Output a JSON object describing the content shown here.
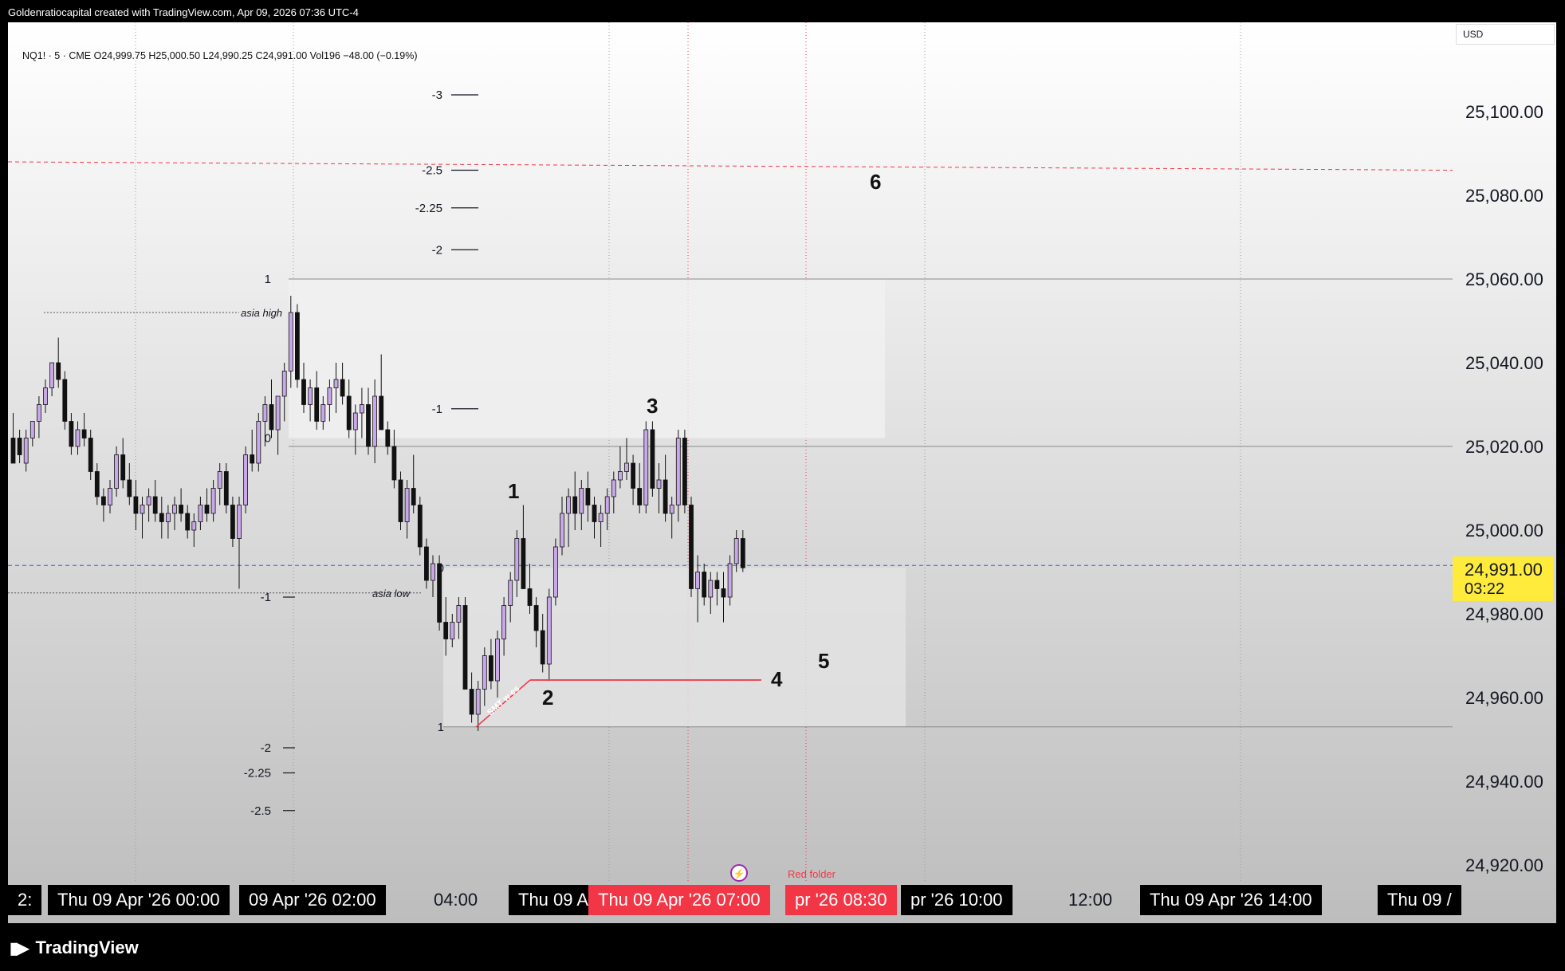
{
  "header": {
    "attribution": "Goldenratiocapital created with TradingView.com, Apr 09, 2026 07:36 UTC-4"
  },
  "legend": {
    "text": "NQ1! · 5 · CME  O24,999.75  H25,000.50  L24,990.25  C24,991.00  Vol196  −48.00 (−0.19%)"
  },
  "price_axis": {
    "currency": "USD",
    "ticks": [
      "25,100.00",
      "25,080.00",
      "25,060.00",
      "25,040.00",
      "25,020.00",
      "25,000.00",
      "24,980.00",
      "24,960.00",
      "24,940.00",
      "24,920.00"
    ],
    "last_price": "24,991.00",
    "countdown": "03:22"
  },
  "time_axis": {
    "labels": [
      {
        "text": "2:",
        "style": "dark"
      },
      {
        "text": "Thu 09 Apr '26   00:00",
        "style": "dark"
      },
      {
        "text": "09 Apr '26   02:00",
        "style": "dark"
      },
      {
        "text": "04:00",
        "style": "plain"
      },
      {
        "text": "Thu 09 A",
        "style": "dark"
      },
      {
        "text": "Thu 09 Apr '26   07:00",
        "style": "red"
      },
      {
        "text": "pr '26   08:30",
        "style": "red"
      },
      {
        "text": "pr '26   10:00",
        "style": "dark"
      },
      {
        "text": "12:00",
        "style": "plain"
      },
      {
        "text": "Thu 09 Apr '26   14:00",
        "style": "dark"
      },
      {
        "text": "Thu 09 /",
        "style": "dark"
      }
    ]
  },
  "footer": {
    "logo": "TradingView"
  },
  "chart_data": {
    "type": "candlestick",
    "symbol": "NQ1!",
    "interval": "5",
    "exchange": "CME",
    "ylim": [
      24910,
      25120
    ],
    "current_price": 24991.0,
    "candles": [
      [
        25022,
        25028,
        25018,
        25016
      ],
      [
        25022,
        25024,
        25016,
        25018
      ],
      [
        25016,
        25024,
        25014,
        25022
      ],
      [
        25022,
        25026,
        25020,
        25026
      ],
      [
        25026,
        25032,
        25022,
        25030
      ],
      [
        25030,
        25036,
        25028,
        25034
      ],
      [
        25034,
        25040,
        25032,
        25040
      ],
      [
        25040,
        25046,
        25034,
        25036
      ],
      [
        25036,
        25038,
        25024,
        25026
      ],
      [
        25026,
        25028,
        25018,
        25020
      ],
      [
        25020,
        25026,
        25018,
        25024
      ],
      [
        25024,
        25028,
        25020,
        25022
      ],
      [
        25022,
        25024,
        25012,
        25014
      ],
      [
        25014,
        25016,
        25006,
        25008
      ],
      [
        25008,
        25010,
        25002,
        25006
      ],
      [
        25006,
        25012,
        25004,
        25010
      ],
      [
        25010,
        25020,
        25008,
        25018
      ],
      [
        25018,
        25022,
        25010,
        25012
      ],
      [
        25012,
        25016,
        25006,
        25008
      ],
      [
        25008,
        25012,
        25000,
        25004
      ],
      [
        25004,
        25008,
        24998,
        25006
      ],
      [
        25006,
        25010,
        25002,
        25008
      ],
      [
        25008,
        25012,
        25002,
        25004
      ],
      [
        25004,
        25008,
        24998,
        25002
      ],
      [
        25002,
        25006,
        24998,
        25004
      ],
      [
        25004,
        25008,
        25000,
        25006
      ],
      [
        25006,
        25010,
        25002,
        25004
      ],
      [
        25004,
        25006,
        24998,
        25000
      ],
      [
        25000,
        25004,
        24996,
        25002
      ],
      [
        25002,
        25008,
        25000,
        25006
      ],
      [
        25006,
        25010,
        25002,
        25004
      ],
      [
        25004,
        25012,
        25002,
        25010
      ],
      [
        25010,
        25016,
        25006,
        25014
      ],
      [
        25014,
        25016,
        25004,
        25006
      ],
      [
        25006,
        25008,
        24996,
        24998
      ],
      [
        24998,
        25008,
        24986,
        25006
      ],
      [
        25006,
        25020,
        25004,
        25018
      ],
      [
        25018,
        25024,
        25014,
        25016
      ],
      [
        25016,
        25028,
        25014,
        25026
      ],
      [
        25026,
        25032,
        25020,
        25030
      ],
      [
        25030,
        25036,
        25022,
        25024
      ],
      [
        25024,
        25032,
        25018,
        25032
      ],
      [
        25032,
        25040,
        25026,
        25038
      ],
      [
        25038,
        25056,
        25034,
        25052
      ],
      [
        25052,
        25054,
        25034,
        25036
      ],
      [
        25036,
        25040,
        25028,
        25030
      ],
      [
        25030,
        25036,
        25026,
        25034
      ],
      [
        25034,
        25038,
        25024,
        25026
      ],
      [
        25026,
        25032,
        25024,
        25030
      ],
      [
        25030,
        25036,
        25026,
        25034
      ],
      [
        25034,
        25040,
        25028,
        25036
      ],
      [
        25036,
        25040,
        25030,
        25032
      ],
      [
        25032,
        25036,
        25022,
        25024
      ],
      [
        25024,
        25030,
        25018,
        25028
      ],
      [
        25028,
        25034,
        25022,
        25030
      ],
      [
        25030,
        25034,
        25018,
        25020
      ],
      [
        25020,
        25036,
        25016,
        25032
      ],
      [
        25032,
        25042,
        25024,
        25024
      ],
      [
        25024,
        25026,
        25018,
        25020
      ],
      [
        25020,
        25024,
        25010,
        25012
      ],
      [
        25012,
        25014,
        25000,
        25002
      ],
      [
        25002,
        25012,
        24998,
        25010
      ],
      [
        25010,
        25018,
        25004,
        25006
      ],
      [
        25006,
        25008,
        24994,
        24996
      ],
      [
        24996,
        24998,
        24986,
        24988
      ],
      [
        24988,
        24994,
        24984,
        24992
      ],
      [
        24992,
        24994,
        24976,
        24978
      ],
      [
        24978,
        24984,
        24970,
        24974
      ],
      [
        24974,
        24980,
        24972,
        24978
      ],
      [
        24978,
        24984,
        24974,
        24982
      ],
      [
        24982,
        24984,
        24962,
        24962
      ],
      [
        24962,
        24966,
        24954,
        24956
      ],
      [
        24956,
        24964,
        24952,
        24962
      ],
      [
        24962,
        24972,
        24958,
        24970
      ],
      [
        24970,
        24974,
        24962,
        24964
      ],
      [
        24964,
        24976,
        24960,
        24974
      ],
      [
        24974,
        24984,
        24970,
        24982
      ],
      [
        24982,
        24990,
        24978,
        24988
      ],
      [
        24988,
        25000,
        24984,
        24998
      ],
      [
        24998,
        25006,
        24986,
        24986
      ],
      [
        24986,
        24992,
        24980,
        24982
      ],
      [
        24982,
        24984,
        24972,
        24976
      ],
      [
        24976,
        24980,
        24966,
        24968
      ],
      [
        24968,
        24986,
        24964,
        24984
      ],
      [
        24984,
        24998,
        24982,
        24996
      ],
      [
        24996,
        25008,
        24994,
        25004
      ],
      [
        25004,
        25010,
        24996,
        25008
      ],
      [
        25008,
        25014,
        25000,
        25004
      ],
      [
        25004,
        25012,
        25000,
        25010
      ],
      [
        25010,
        25014,
        25002,
        25006
      ],
      [
        25006,
        25008,
        24998,
        25002
      ],
      [
        25002,
        25006,
        24996,
        25004
      ],
      [
        25004,
        25010,
        25000,
        25008
      ],
      [
        25008,
        25014,
        25004,
        25012
      ],
      [
        25012,
        25020,
        25010,
        25014
      ],
      [
        25014,
        25022,
        25012,
        25016
      ],
      [
        25016,
        25018,
        25006,
        25010
      ],
      [
        25010,
        25016,
        25004,
        25006
      ],
      [
        25006,
        25026,
        25004,
        25024
      ],
      [
        25024,
        25026,
        25008,
        25010
      ],
      [
        25010,
        25016,
        25004,
        25012
      ],
      [
        25012,
        25018,
        25002,
        25004
      ],
      [
        25004,
        25008,
        24998,
        25006
      ],
      [
        25006,
        25024,
        25002,
        25022
      ],
      [
        25022,
        25024,
        25004,
        25006
      ],
      [
        25006,
        25008,
        24984,
        24986
      ],
      [
        24986,
        24994,
        24978,
        24990
      ],
      [
        24990,
        24992,
        24982,
        24984
      ],
      [
        24984,
        24990,
        24980,
        24988
      ],
      [
        24988,
        24990,
        24982,
        24986
      ],
      [
        24986,
        24990,
        24978,
        24984
      ],
      [
        24984,
        24994,
        24982,
        24992
      ],
      [
        24992,
        25000,
        24990,
        24998
      ],
      [
        24998,
        25000,
        24990,
        24991
      ]
    ],
    "horizontal_levels": [
      {
        "price": 25088,
        "style": "red-dashed"
      },
      {
        "price": 24991,
        "style": "blue-dashed"
      },
      {
        "price": 25060,
        "style": "thin-gray"
      },
      {
        "price": 25020,
        "style": "thin-gray"
      },
      {
        "price": 24953,
        "style": "thin-gray"
      }
    ],
    "session_markers": [
      {
        "label": "asia high",
        "price": 25052
      },
      {
        "label": "asia low",
        "price": 24985
      }
    ],
    "fib_labels": [
      {
        "label": "-3",
        "price": 25104
      },
      {
        "label": "-2.5",
        "price": 25086
      },
      {
        "label": "-2.25",
        "price": 25077
      },
      {
        "label": "-2",
        "price": 25067
      },
      {
        "label": "1",
        "price": 25060
      },
      {
        "label": "-1",
        "price": 25029
      },
      {
        "label": "0",
        "price": 25022
      },
      {
        "label": "0",
        "price": 24991
      },
      {
        "label": "-1",
        "price": 24984
      },
      {
        "label": "1",
        "price": 24953
      },
      {
        "label": "-2",
        "price": 24948
      },
      {
        "label": "-2.25",
        "price": 24942
      },
      {
        "label": "-2.5",
        "price": 24933
      }
    ],
    "annotations": [
      "1",
      "2",
      "3",
      "4",
      "5",
      "6",
      "SMT w es"
    ],
    "event_marker": "Red folder"
  }
}
